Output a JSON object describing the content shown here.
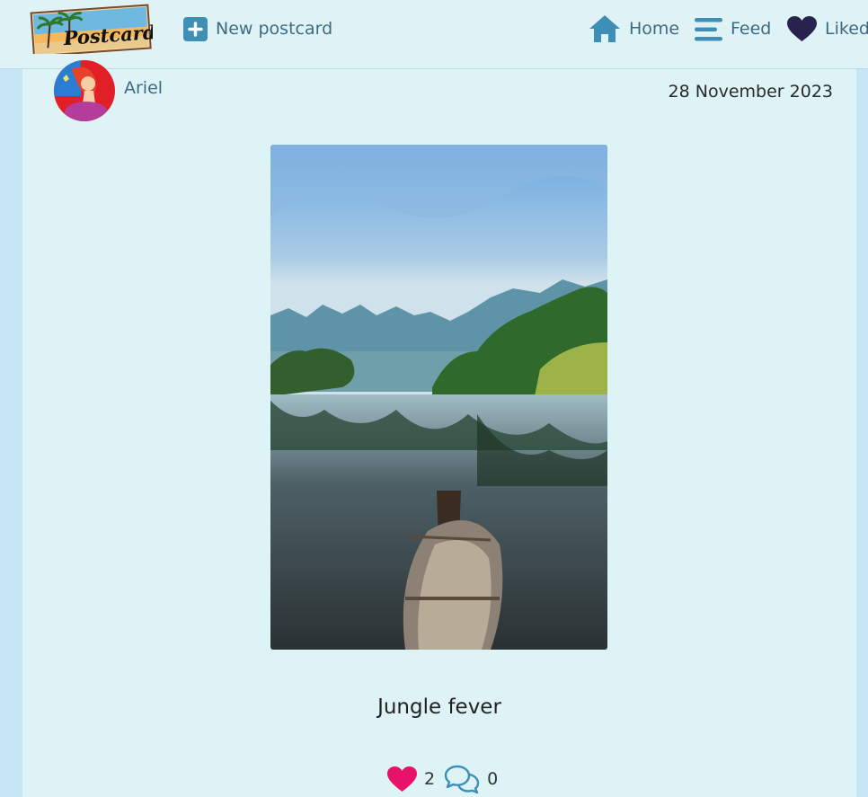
{
  "nav": {
    "logo_text": "Postcards",
    "new_postcard_label": "New postcard",
    "home_label": "Home",
    "feed_label": "Feed",
    "liked_label": "Liked"
  },
  "post": {
    "author": "Ariel",
    "date": "28 November 2023",
    "caption": "Jungle fever",
    "likes_count": "2",
    "comments_count": "0"
  },
  "colors": {
    "nav_bg": "#dff3f7",
    "card_bg": "#ddf3f6",
    "accent": "#3d8fb5",
    "like_heart": "#e8126b",
    "liked_heart": "#27234e"
  },
  "icons": [
    "plus-square-icon",
    "home-icon",
    "menu-bars-icon",
    "heart-icon",
    "comments-icon"
  ]
}
